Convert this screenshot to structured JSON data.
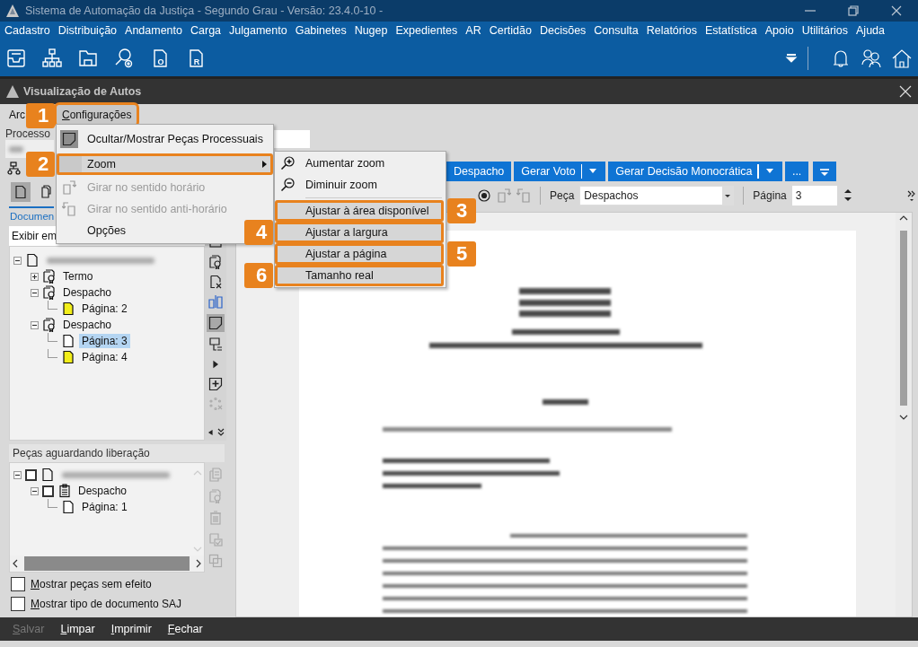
{
  "app_window": {
    "title": "Sistema de Automação da Justiça - Segundo Grau - Versão: 23.4.0-10 -",
    "menu": [
      "Cadastro",
      "Distribuição",
      "Andamento",
      "Carga",
      "Julgamento",
      "Gabinetes",
      "Nugep",
      "Expedientes",
      "AR",
      "Certidão",
      "Decisões",
      "Consulta",
      "Relatórios",
      "Estatística",
      "Apoio",
      "Utilitários",
      "Ajuda"
    ],
    "toolbar": [
      {
        "kind": "inbox"
      },
      {
        "kind": "org_chart"
      },
      {
        "kind": "folder"
      },
      {
        "kind": "search_settings"
      },
      {
        "kind": "document",
        "letter": "O"
      },
      {
        "kind": "document",
        "letter": "R"
      }
    ]
  },
  "inner_window": {
    "title": "Visualização de Autos",
    "menu": [
      {
        "label": "Arc",
        "selected": false
      },
      {
        "label": "Configurações",
        "selected": true,
        "callout": "1"
      }
    ]
  },
  "left_panel": {
    "process_label": "Processo",
    "view_toggles": [
      {
        "kind": "page",
        "on": true
      },
      {
        "kind": "pages",
        "on": false
      }
    ],
    "tab": "Documen",
    "display_select": "Exibir em",
    "tree": [
      {
        "kind": "process",
        "expanded": true,
        "children": [
          {
            "kind": "piece",
            "label": "Termo",
            "expanded": false,
            "selected": false
          },
          {
            "kind": "piece",
            "label": "Despacho",
            "expanded": true,
            "selected": false,
            "children": [
              {
                "kind": "page",
                "label": "Página: 2",
                "color": "#f2ee1a",
                "selected": false
              }
            ]
          },
          {
            "kind": "piece",
            "label": "Despacho",
            "expanded": true,
            "selected": false,
            "children": [
              {
                "kind": "page",
                "label": "Página: 3",
                "color": "#ffffff",
                "selected": true
              },
              {
                "kind": "page",
                "label": "Página: 4",
                "color": "#f2ee1a",
                "selected": false
              }
            ]
          }
        ]
      }
    ],
    "side_tools": [
      {
        "kind": "rows",
        "on": false,
        "disabled": false
      },
      {
        "kind": "seal",
        "on": false,
        "disabled": false
      },
      {
        "kind": "doc_remove",
        "on": false,
        "disabled": false
      },
      {
        "kind": "compare",
        "on": false,
        "disabled": false
      },
      {
        "kind": "note",
        "on": true,
        "disabled": false
      },
      {
        "kind": "doc_list",
        "on": false,
        "disabled": false
      },
      {
        "kind": "triangle",
        "on": false,
        "disabled": false
      },
      {
        "kind": "note_add",
        "on": false,
        "disabled": false
      },
      {
        "kind": "spinner_remove",
        "on": false,
        "disabled": true
      }
    ],
    "pending_title": "Peças aguardando liberação",
    "pending_tree": [
      {
        "kind": "process",
        "expanded": true,
        "checked": false,
        "children": [
          {
            "kind": "draft",
            "label": "Despacho",
            "expanded": true,
            "checked": false,
            "children": [
              {
                "kind": "page",
                "label": "Página: 1",
                "color": "#ffffff"
              }
            ]
          }
        ]
      }
    ],
    "pending_tools": [
      {
        "kind": "copy_doc",
        "disabled": true
      },
      {
        "kind": "seal",
        "disabled": true
      },
      {
        "kind": "trash",
        "disabled": true
      },
      {
        "kind": "check_list",
        "disabled": true
      },
      {
        "kind": "copy",
        "disabled": true
      }
    ],
    "options": [
      {
        "label": "Mostrar peças sem efeito",
        "checked": false
      },
      {
        "label": "Mostrar tipo de documento SAJ",
        "checked": false
      }
    ]
  },
  "viewer_toolbar": {
    "buttons": [
      {
        "label": "Despacho",
        "kind": "plain"
      },
      {
        "label": "Gerar Voto",
        "kind": "split"
      },
      {
        "label": "Gerar Decisão Monocrática",
        "kind": "split"
      },
      {
        "label": "...",
        "kind": "plain"
      },
      {
        "kind": "filter"
      }
    ],
    "tools": [
      {
        "kind": "zoom",
        "disabled": false
      },
      {
        "kind": "rotate_cw",
        "disabled": true
      },
      {
        "kind": "rotate_ccw",
        "disabled": true
      }
    ],
    "piece_label": "Peça",
    "piece_value": "Despachos",
    "page_label": "Página",
    "page_value": "3"
  },
  "footer_buttons": [
    {
      "label": "Salvar",
      "disabled": true
    },
    {
      "label": "Limpar",
      "disabled": false
    },
    {
      "label": "Imprimir",
      "disabled": false
    },
    {
      "label": "Fechar",
      "disabled": false
    }
  ],
  "config_menu": {
    "items": [
      {
        "label": "Ocultar/Mostrar Peças Processuais",
        "kind": "toggle",
        "checked": true,
        "selected": false,
        "disabled": false
      },
      {
        "label": "Zoom",
        "kind": "submenu",
        "selected": true,
        "disabled": false,
        "callout": "2"
      },
      {
        "label": "Girar no sentido horário",
        "kind": "rotate_cw",
        "selected": false,
        "disabled": true
      },
      {
        "label": "Girar no sentido anti-horário",
        "kind": "rotate_ccw",
        "selected": false,
        "disabled": true
      },
      {
        "label": "Opções",
        "kind": "plain",
        "selected": false,
        "disabled": false
      }
    ]
  },
  "zoom_submenu": {
    "items": [
      {
        "label": "Aumentar zoom",
        "kind": "zoom_in"
      },
      {
        "label": "Diminuir zoom",
        "kind": "zoom_out"
      },
      {
        "label": "Ajustar à área disponível",
        "kind": "plain",
        "callout": "3"
      },
      {
        "label": "Ajustar a largura",
        "kind": "plain",
        "callout": "4"
      },
      {
        "label": "Ajustar a página",
        "kind": "plain",
        "callout": "5"
      },
      {
        "label": "Tamanho real",
        "kind": "plain",
        "callout": "6"
      }
    ]
  }
}
